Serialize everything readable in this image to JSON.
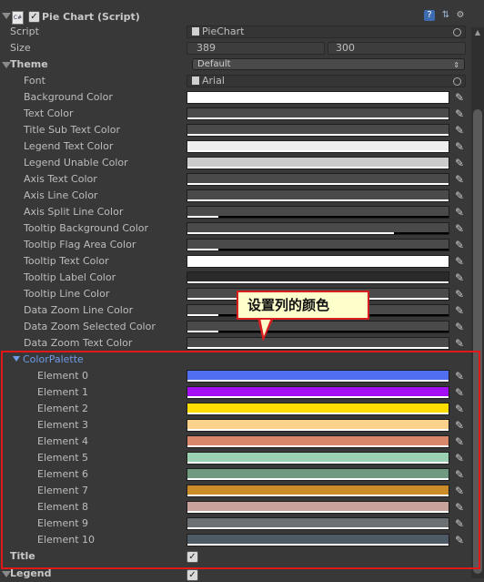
{
  "header": {
    "title": "Pie Chart (Script)",
    "enabled": true,
    "icons": [
      "help-icon",
      "settings-icon",
      "gear-icon"
    ]
  },
  "script": {
    "label": "Script",
    "value": "PieChart"
  },
  "size": {
    "label": "Size",
    "width": "389",
    "height": "300"
  },
  "theme": {
    "label": "Theme",
    "value": "Default"
  },
  "font": {
    "label": "Font",
    "value": "Arial"
  },
  "color_props": [
    {
      "label": "Background Color",
      "color": "#ffffff",
      "alpha": 1.0
    },
    {
      "label": "Text Color",
      "color": "#4a4a4a",
      "alpha": 1.0
    },
    {
      "label": "Title Sub Text Color",
      "color": "#4a4a4a",
      "alpha": 1.0
    },
    {
      "label": "Legend Text Color",
      "color": "#eeeeee",
      "alpha": 1.0
    },
    {
      "label": "Legend Unable Color",
      "color": "#cccccc",
      "alpha": 1.0
    },
    {
      "label": "Axis Text Color",
      "color": "#4a4a4a",
      "alpha": 1.0
    },
    {
      "label": "Axis Line Color",
      "color": "#4a4a4a",
      "alpha": 1.0
    },
    {
      "label": "Axis Split Line Color",
      "color": "#4a4a4a",
      "alpha": 0.12
    },
    {
      "label": "Tooltip Background Color",
      "color": "#4a4a4a",
      "alpha": 0.79
    },
    {
      "label": "Tooltip Flag Area Color",
      "color": "#4a4a4a",
      "alpha": 0.12
    },
    {
      "label": "Tooltip Text Color",
      "color": "#ffffff",
      "alpha": 1.0
    },
    {
      "label": "Tooltip Label Color",
      "color": "#2a2a2a",
      "alpha": 1.0
    },
    {
      "label": "Tooltip Line Color",
      "color": "#4a4a4a",
      "alpha": 1.0
    },
    {
      "label": "Data Zoom Line Color",
      "color": "#4a4a4a",
      "alpha": 0.12
    },
    {
      "label": "Data Zoom Selected Color",
      "color": "#4a4a4a",
      "alpha": 0.12
    },
    {
      "label": "Data Zoom Text Color",
      "color": "#4a4a4a",
      "alpha": 1.0
    }
  ],
  "palette": {
    "label": "ColorPalette",
    "elements": [
      {
        "label": "Element 0",
        "color": "#4f6ef2"
      },
      {
        "label": "Element 1",
        "color": "#a30ff2"
      },
      {
        "label": "Element 2",
        "color": "#ffdd00"
      },
      {
        "label": "Element 3",
        "color": "#ffd28c"
      },
      {
        "label": "Element 4",
        "color": "#d9876a"
      },
      {
        "label": "Element 5",
        "color": "#9bd1b3"
      },
      {
        "label": "Element 6",
        "color": "#6f9a7f"
      },
      {
        "label": "Element 7",
        "color": "#cc8b29"
      },
      {
        "label": "Element 8",
        "color": "#c9a29b"
      },
      {
        "label": "Element 9",
        "color": "#6c7072"
      },
      {
        "label": "Element 10",
        "color": "#4e5a66"
      }
    ]
  },
  "title_prop": {
    "label": "Title",
    "checked": true
  },
  "legend_prop": {
    "label": "Legend",
    "checked": true
  },
  "callout": {
    "text": "设置列的颜色"
  }
}
